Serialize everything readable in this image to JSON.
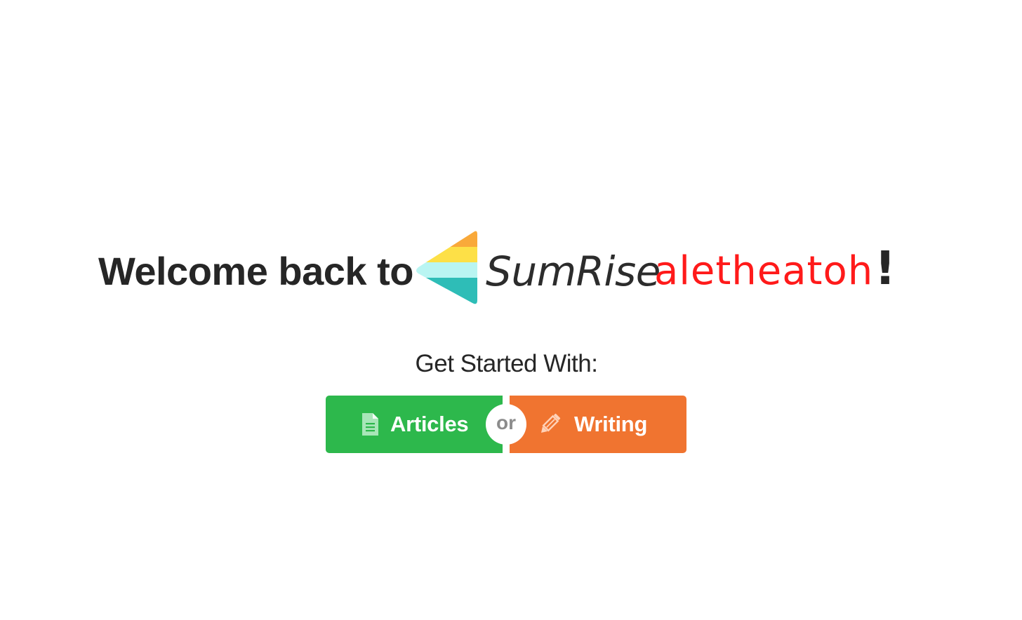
{
  "welcome": {
    "prefix": "Welcome back to",
    "brand_name": "SumRise",
    "username": "aletheatoh",
    "exclamation": "!"
  },
  "get_started": {
    "title": "Get Started With:"
  },
  "buttons": {
    "articles": {
      "label": "Articles",
      "icon": "document-icon",
      "color": "#2db84c"
    },
    "or_label": "or",
    "writing": {
      "label": "Writing",
      "icon": "pencil-icon",
      "color": "#f07430"
    }
  },
  "colors": {
    "username": "#ff1a1a",
    "text": "#262626",
    "logo_orange": "#f9a93a",
    "logo_yellow": "#fde047",
    "logo_lightblue": "#b9f5f2",
    "logo_teal": "#2ebdb7"
  }
}
